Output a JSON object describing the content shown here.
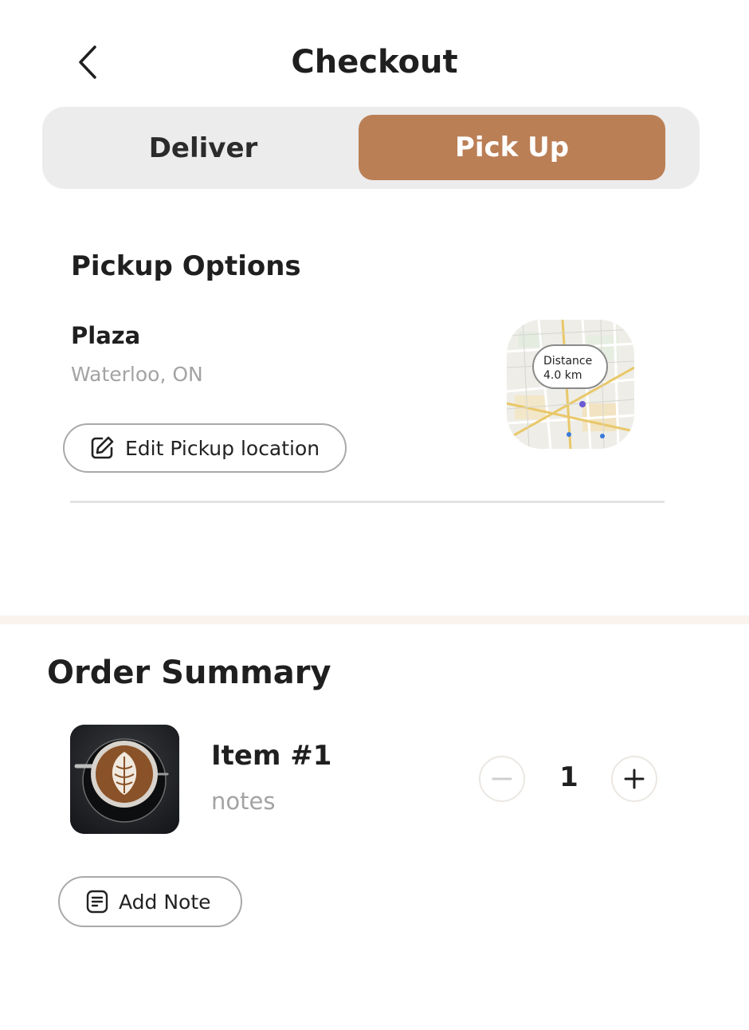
{
  "header": {
    "title": "Checkout"
  },
  "mode_toggle": {
    "options": [
      "Deliver",
      "Pick Up"
    ],
    "selected": "Pick Up"
  },
  "pickup": {
    "heading": "Pickup Options",
    "store_name": "Plaza",
    "store_address": "Waterloo, ON",
    "edit_label": "Edit Pickup location",
    "map": {
      "badge_line1": "Distance",
      "badge_line2": "4.0 km"
    }
  },
  "order": {
    "heading": "Order Summary",
    "items": [
      {
        "name": "Item #1",
        "notes": "notes",
        "quantity": "1"
      }
    ],
    "add_note_label": "Add Note"
  },
  "icons": {
    "back": "chevron-left-icon",
    "edit": "edit-square-icon",
    "minus": "minus-icon",
    "plus": "plus-icon",
    "note": "note-document-icon"
  },
  "colors": {
    "accent": "#bb7f56",
    "toggle_bg": "#ececec",
    "muted_text": "#a3a3a3",
    "band": "#faf2ed"
  }
}
